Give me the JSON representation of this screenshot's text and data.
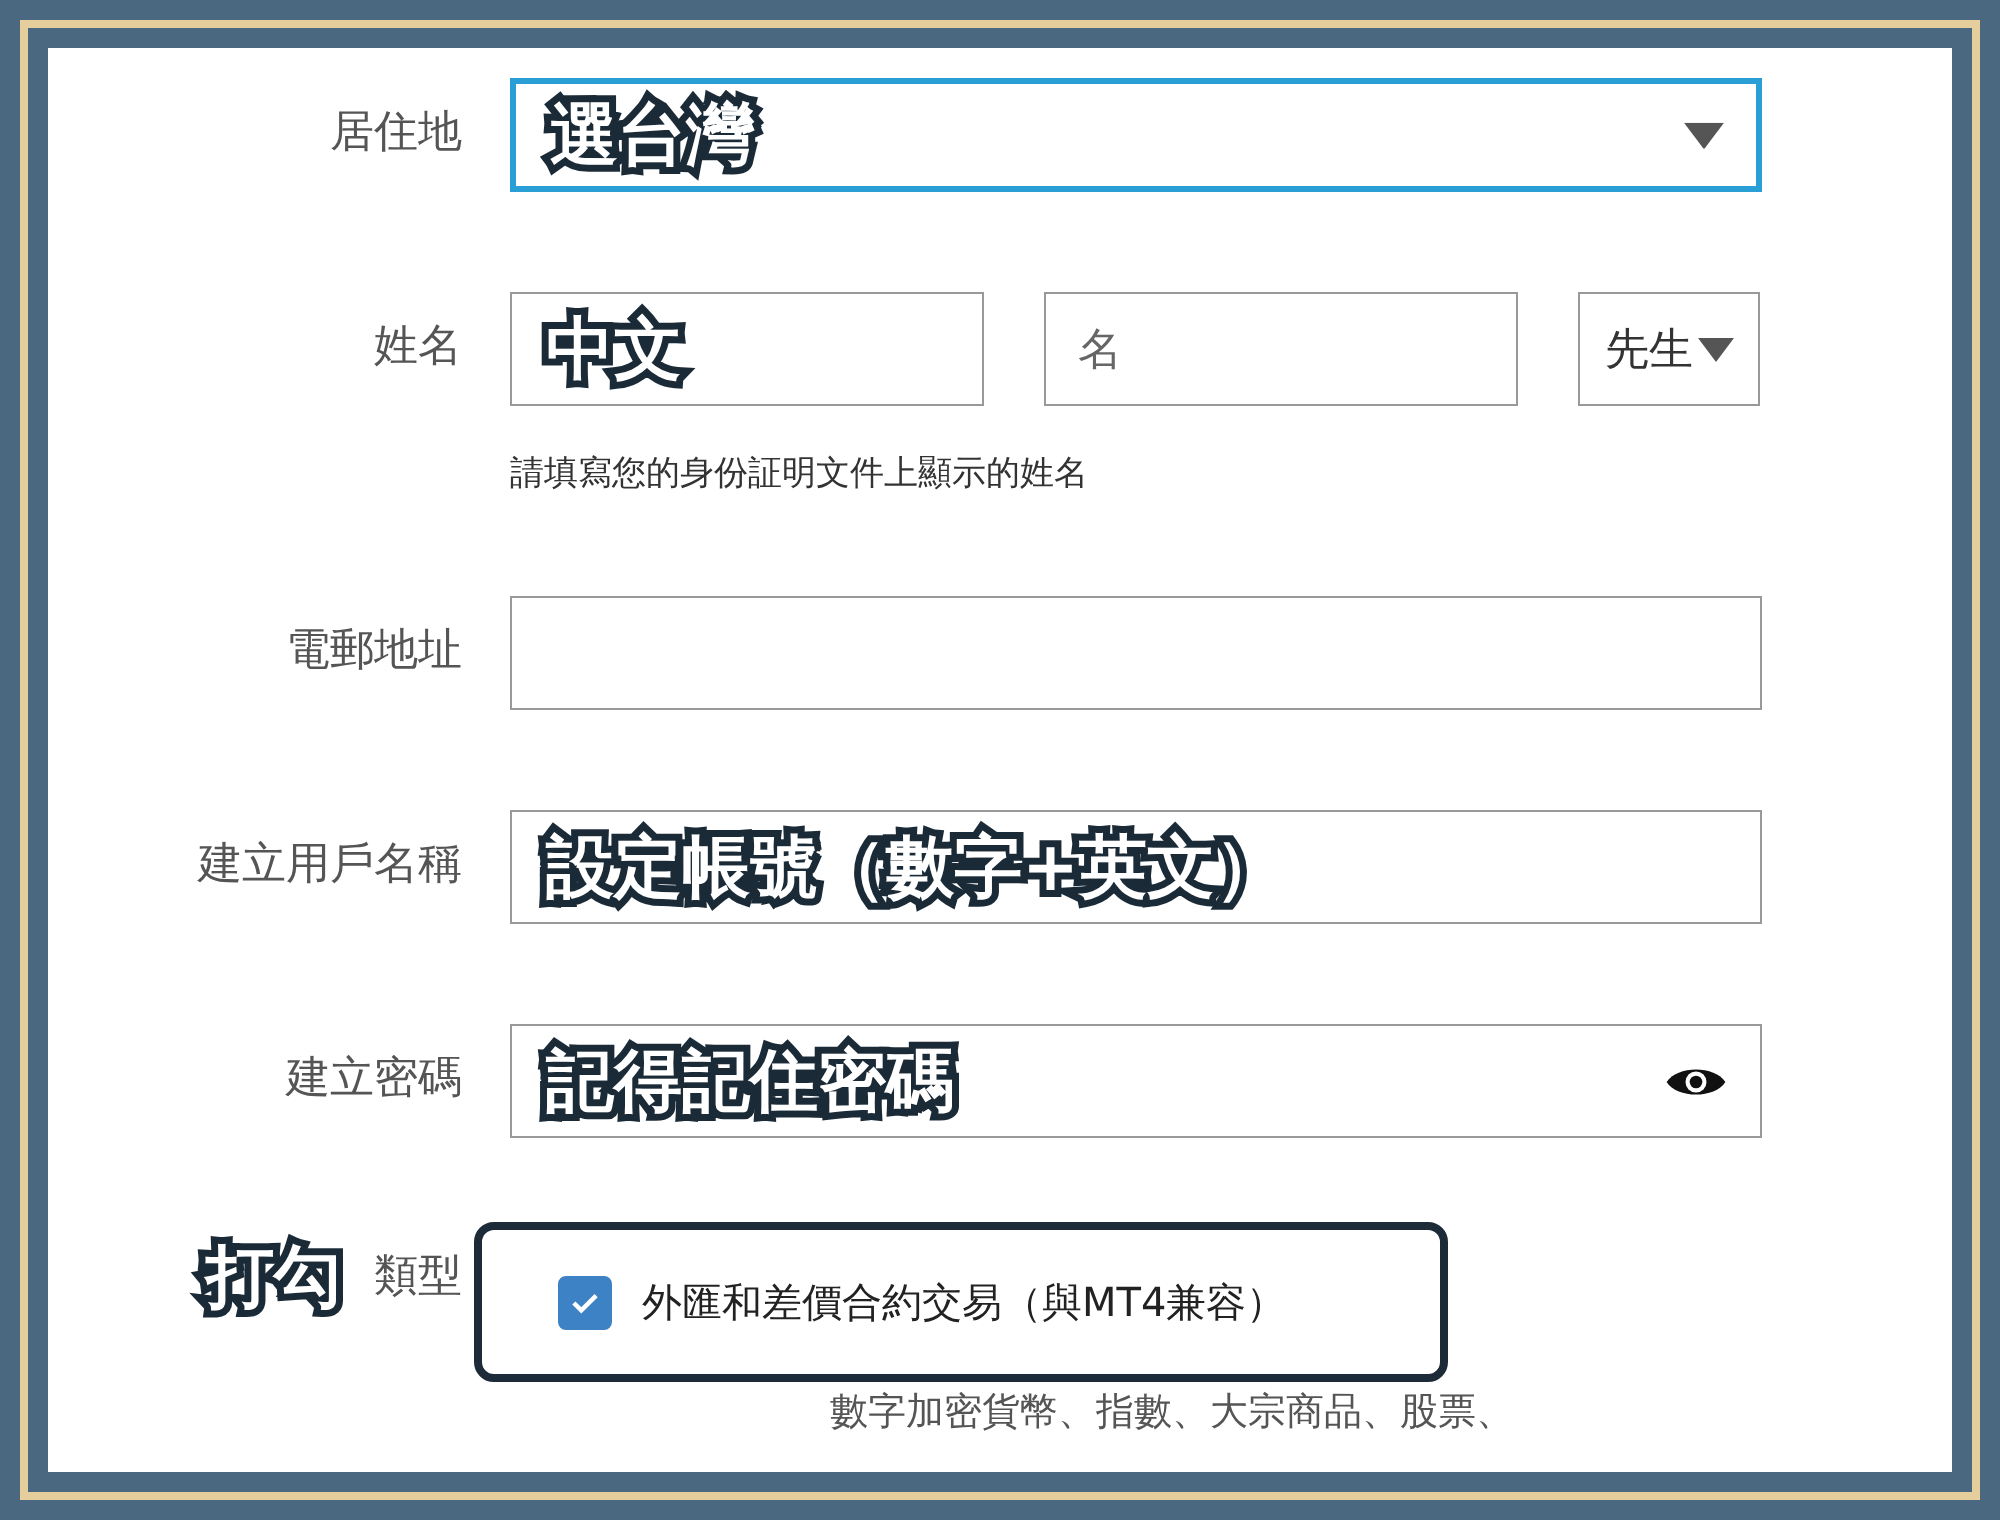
{
  "form": {
    "fields": [
      {
        "kind": "select",
        "label": "居住地",
        "focused": true,
        "annotation": "選台灣"
      },
      {
        "kind": "name",
        "label": "姓名",
        "annotation": "中文",
        "first_name": {
          "placeholder": "名"
        },
        "title_select": {
          "value": "先生"
        },
        "hint": "請填寫您的身份証明文件上顯示的姓名"
      },
      {
        "kind": "text",
        "label": "電郵地址"
      },
      {
        "kind": "text",
        "label": "建立用戶名稱",
        "annotation": "設定帳號（數字+英文）"
      },
      {
        "kind": "password",
        "label": "建立密碼",
        "annotation": "記得記住密碼"
      },
      {
        "kind": "checkbox",
        "label": "類型",
        "annotation": "打勾",
        "highlighted": true,
        "option": {
          "label": "外匯和差價合約交易（與MT4兼容）",
          "checked": true
        },
        "description": "數字加密貨幣、指數、大宗商品、股票、"
      }
    ]
  }
}
